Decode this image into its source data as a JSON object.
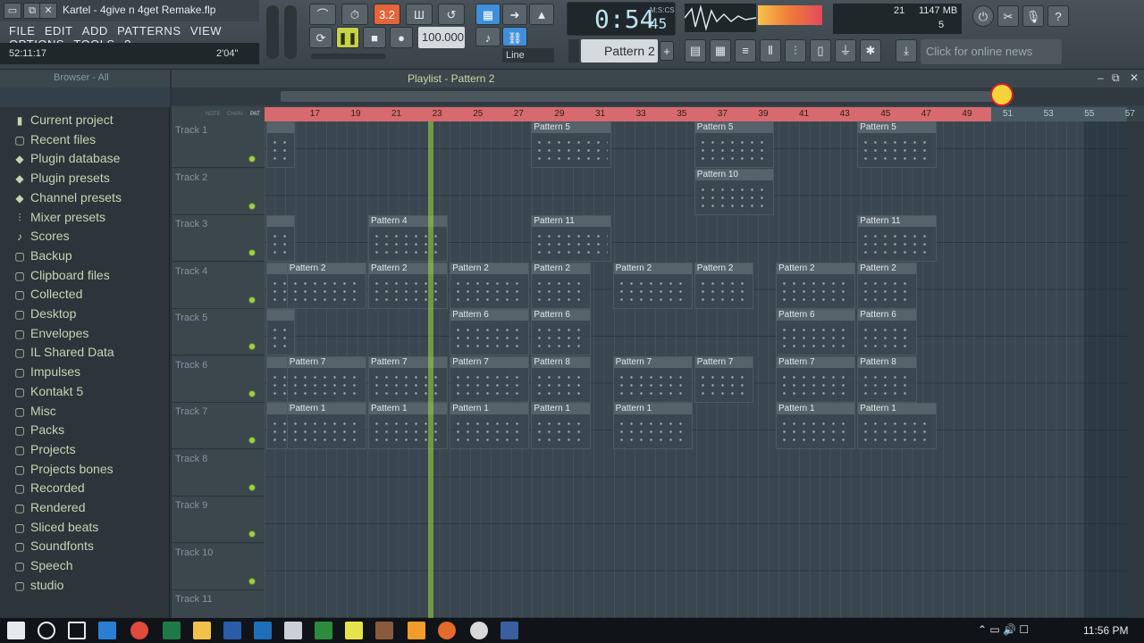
{
  "window": {
    "title": "Kartel - 4give n 4get Remake.flp"
  },
  "menu": [
    "FILE",
    "EDIT",
    "ADD",
    "PATTERNS",
    "VIEW",
    "OPTIONS",
    "TOOLS",
    "?"
  ],
  "hint": {
    "left": "52:11:17",
    "right": "2'04\""
  },
  "transport": {
    "time": "0:54",
    "time_sub": "45",
    "time_unit": "M:S:CS",
    "tempo": "100.000",
    "snap": "Line",
    "pattern": "Pattern 2",
    "pattern_plus": "+",
    "cpu_mem": "1147 MB",
    "cpu_num": "21",
    "poly": "5",
    "news": "Click for online news"
  },
  "browser": {
    "title": "Browser - All",
    "items": [
      {
        "label": "Current project",
        "icon": "project-icon"
      },
      {
        "label": "Recent files",
        "icon": "folder-icon"
      },
      {
        "label": "Plugin database",
        "icon": "plugin-icon"
      },
      {
        "label": "Plugin presets",
        "icon": "plugin-icon"
      },
      {
        "label": "Channel presets",
        "icon": "plugin-icon"
      },
      {
        "label": "Mixer presets",
        "icon": "mixer-icon"
      },
      {
        "label": "Scores",
        "icon": "note-icon"
      },
      {
        "label": "Backup",
        "icon": "folder-icon"
      },
      {
        "label": "Clipboard files",
        "icon": "folder-icon"
      },
      {
        "label": "Collected",
        "icon": "folder-icon"
      },
      {
        "label": "Desktop",
        "icon": "folder-icon"
      },
      {
        "label": "Envelopes",
        "icon": "folder-icon"
      },
      {
        "label": "IL Shared Data",
        "icon": "folder-icon"
      },
      {
        "label": "Impulses",
        "icon": "folder-icon"
      },
      {
        "label": "Kontakt 5",
        "icon": "folder-icon"
      },
      {
        "label": "Misc",
        "icon": "folder-icon"
      },
      {
        "label": "Packs",
        "icon": "folder-icon"
      },
      {
        "label": "Projects",
        "icon": "folder-icon"
      },
      {
        "label": "Projects bones",
        "icon": "folder-icon"
      },
      {
        "label": "Recorded",
        "icon": "folder-icon"
      },
      {
        "label": "Rendered",
        "icon": "folder-icon"
      },
      {
        "label": "Sliced beats",
        "icon": "folder-icon"
      },
      {
        "label": "Soundfonts",
        "icon": "folder-icon"
      },
      {
        "label": "Speech",
        "icon": "folder-icon"
      },
      {
        "label": "studio",
        "icon": "folder-icon"
      }
    ]
  },
  "playlist": {
    "title": "Playlist - Pattern 2",
    "header_labels": {
      "note": "NOTE",
      "chan": "CHAN",
      "pat": "PAT"
    },
    "ruler": [
      "17",
      "19",
      "21",
      "23",
      "25",
      "27",
      "29",
      "31",
      "33",
      "35",
      "37",
      "39",
      "41",
      "43",
      "45",
      "47",
      "49",
      "51",
      "53",
      "55",
      "57"
    ],
    "tracks": [
      "Track 1",
      "Track 2",
      "Track 3",
      "Track 4",
      "Track 5",
      "Track 6",
      "Track 7",
      "Track 8",
      "Track 9",
      "Track 10",
      "Track 11"
    ],
    "clips": [
      {
        "track": 0,
        "bar": 16,
        "len": 1.5,
        "label": ""
      },
      {
        "track": 0,
        "bar": 29,
        "len": 4,
        "label": "Pattern 5"
      },
      {
        "track": 0,
        "bar": 37,
        "len": 4,
        "label": "Pattern 5"
      },
      {
        "track": 0,
        "bar": 45,
        "len": 4,
        "label": "Pattern 5"
      },
      {
        "track": 1,
        "bar": 37,
        "len": 4,
        "label": "Pattern 10"
      },
      {
        "track": 2,
        "bar": 16,
        "len": 1.5,
        "label": ""
      },
      {
        "track": 2,
        "bar": 21,
        "len": 4,
        "label": "Pattern 4"
      },
      {
        "track": 2,
        "bar": 29,
        "len": 4,
        "label": "Pattern 11"
      },
      {
        "track": 2,
        "bar": 45,
        "len": 4,
        "label": "Pattern 11"
      },
      {
        "track": 3,
        "bar": 16,
        "len": 1.5,
        "label": ""
      },
      {
        "track": 3,
        "bar": 17,
        "len": 4,
        "label": "Pattern 2"
      },
      {
        "track": 3,
        "bar": 21,
        "len": 4,
        "label": "Pattern 2"
      },
      {
        "track": 3,
        "bar": 25,
        "len": 4,
        "label": "Pattern 2"
      },
      {
        "track": 3,
        "bar": 29,
        "len": 3,
        "label": "Pattern 2"
      },
      {
        "track": 3,
        "bar": 33,
        "len": 4,
        "label": "Pattern 2"
      },
      {
        "track": 3,
        "bar": 37,
        "len": 3,
        "label": "Pattern 2"
      },
      {
        "track": 3,
        "bar": 41,
        "len": 4,
        "label": "Pattern 2"
      },
      {
        "track": 3,
        "bar": 45,
        "len": 3,
        "label": "Pattern 2"
      },
      {
        "track": 4,
        "bar": 16,
        "len": 1.5,
        "label": ""
      },
      {
        "track": 4,
        "bar": 25,
        "len": 4,
        "label": "Pattern 6"
      },
      {
        "track": 4,
        "bar": 29,
        "len": 3,
        "label": "Pattern 6"
      },
      {
        "track": 4,
        "bar": 41,
        "len": 4,
        "label": "Pattern 6"
      },
      {
        "track": 4,
        "bar": 45,
        "len": 3,
        "label": "Pattern 6"
      },
      {
        "track": 5,
        "bar": 16,
        "len": 1.5,
        "label": ""
      },
      {
        "track": 5,
        "bar": 17,
        "len": 4,
        "label": "Pattern 7"
      },
      {
        "track": 5,
        "bar": 21,
        "len": 4,
        "label": "Pattern 7"
      },
      {
        "track": 5,
        "bar": 25,
        "len": 4,
        "label": "Pattern 7"
      },
      {
        "track": 5,
        "bar": 29,
        "len": 3,
        "label": "Pattern 8"
      },
      {
        "track": 5,
        "bar": 33,
        "len": 4,
        "label": "Pattern 7"
      },
      {
        "track": 5,
        "bar": 37,
        "len": 3,
        "label": "Pattern 7"
      },
      {
        "track": 5,
        "bar": 41,
        "len": 4,
        "label": "Pattern 7"
      },
      {
        "track": 5,
        "bar": 45,
        "len": 3,
        "label": "Pattern 8"
      },
      {
        "track": 6,
        "bar": 16,
        "len": 1.5,
        "label": ""
      },
      {
        "track": 6,
        "bar": 17,
        "len": 4,
        "label": "Pattern 1"
      },
      {
        "track": 6,
        "bar": 21,
        "len": 4,
        "label": "Pattern 1"
      },
      {
        "track": 6,
        "bar": 25,
        "len": 4,
        "label": "Pattern 1"
      },
      {
        "track": 6,
        "bar": 29,
        "len": 3,
        "label": "Pattern 1"
      },
      {
        "track": 6,
        "bar": 33,
        "len": 4,
        "label": "Pattern 1"
      },
      {
        "track": 6,
        "bar": 41,
        "len": 4,
        "label": "Pattern 1"
      },
      {
        "track": 6,
        "bar": 45,
        "len": 4,
        "label": "Pattern 1"
      }
    ]
  },
  "taskbar": {
    "time": "11:56 PM"
  },
  "colors": {
    "accent": "#3f8fd8",
    "playhead": "#9bdc3c",
    "ruler": "#d76a6e"
  }
}
